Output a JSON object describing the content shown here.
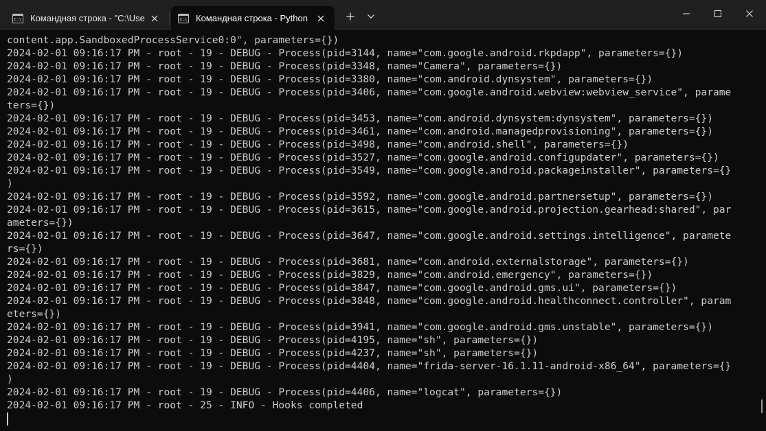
{
  "tabs": [
    {
      "label": "Командная строка - \"C:\\Users",
      "icon": "cmd-icon",
      "active": false
    },
    {
      "label": "Командная строка - Python",
      "icon": "cmd-icon",
      "active": true
    }
  ],
  "toolbar": {
    "new_tab_icon": "plus-icon",
    "dropdown_icon": "chevron-down-icon"
  },
  "window_controls": [
    "minimize-icon",
    "maximize-icon",
    "close-icon"
  ],
  "console": {
    "lines": [
      "content.app.SandboxedProcessService0:0\", parameters={})",
      "2024-02-01 09:16:17 PM - root - 19 - DEBUG - Process(pid=3144, name=\"com.google.android.rkpdapp\", parameters={})",
      "2024-02-01 09:16:17 PM - root - 19 - DEBUG - Process(pid=3348, name=\"Camera\", parameters={})",
      "2024-02-01 09:16:17 PM - root - 19 - DEBUG - Process(pid=3380, name=\"com.android.dynsystem\", parameters={})",
      "2024-02-01 09:16:17 PM - root - 19 - DEBUG - Process(pid=3406, name=\"com.google.android.webview:webview_service\", parame",
      "ters={})",
      "2024-02-01 09:16:17 PM - root - 19 - DEBUG - Process(pid=3453, name=\"com.android.dynsystem:dynsystem\", parameters={})",
      "2024-02-01 09:16:17 PM - root - 19 - DEBUG - Process(pid=3461, name=\"com.android.managedprovisioning\", parameters={})",
      "2024-02-01 09:16:17 PM - root - 19 - DEBUG - Process(pid=3498, name=\"com.android.shell\", parameters={})",
      "2024-02-01 09:16:17 PM - root - 19 - DEBUG - Process(pid=3527, name=\"com.google.android.configupdater\", parameters={})",
      "2024-02-01 09:16:17 PM - root - 19 - DEBUG - Process(pid=3549, name=\"com.google.android.packageinstaller\", parameters={}",
      ")",
      "2024-02-01 09:16:17 PM - root - 19 - DEBUG - Process(pid=3592, name=\"com.google.android.partnersetup\", parameters={})",
      "2024-02-01 09:16:17 PM - root - 19 - DEBUG - Process(pid=3615, name=\"com.google.android.projection.gearhead:shared\", par",
      "ameters={})",
      "2024-02-01 09:16:17 PM - root - 19 - DEBUG - Process(pid=3647, name=\"com.google.android.settings.intelligence\", paramete",
      "rs={})",
      "2024-02-01 09:16:17 PM - root - 19 - DEBUG - Process(pid=3681, name=\"com.android.externalstorage\", parameters={})",
      "2024-02-01 09:16:17 PM - root - 19 - DEBUG - Process(pid=3829, name=\"com.android.emergency\", parameters={})",
      "2024-02-01 09:16:17 PM - root - 19 - DEBUG - Process(pid=3847, name=\"com.google.android.gms.ui\", parameters={})",
      "2024-02-01 09:16:17 PM - root - 19 - DEBUG - Process(pid=3848, name=\"com.google.android.healthconnect.controller\", param",
      "eters={})",
      "2024-02-01 09:16:17 PM - root - 19 - DEBUG - Process(pid=3941, name=\"com.google.android.gms.unstable\", parameters={})",
      "2024-02-01 09:16:17 PM - root - 19 - DEBUG - Process(pid=4195, name=\"sh\", parameters={})",
      "2024-02-01 09:16:17 PM - root - 19 - DEBUG - Process(pid=4237, name=\"sh\", parameters={})",
      "2024-02-01 09:16:17 PM - root - 19 - DEBUG - Process(pid=4404, name=\"frida-server-16.1.11-android-x86_64\", parameters={}",
      ")",
      "2024-02-01 09:16:17 PM - root - 19 - DEBUG - Process(pid=4406, name=\"logcat\", parameters={})",
      "2024-02-01 09:16:17 PM - root - 25 - INFO - Hooks completed"
    ]
  },
  "colors": {
    "titlebar_bg": "#202020",
    "console_bg": "#0c0c0c",
    "console_text": "#cccccc"
  }
}
